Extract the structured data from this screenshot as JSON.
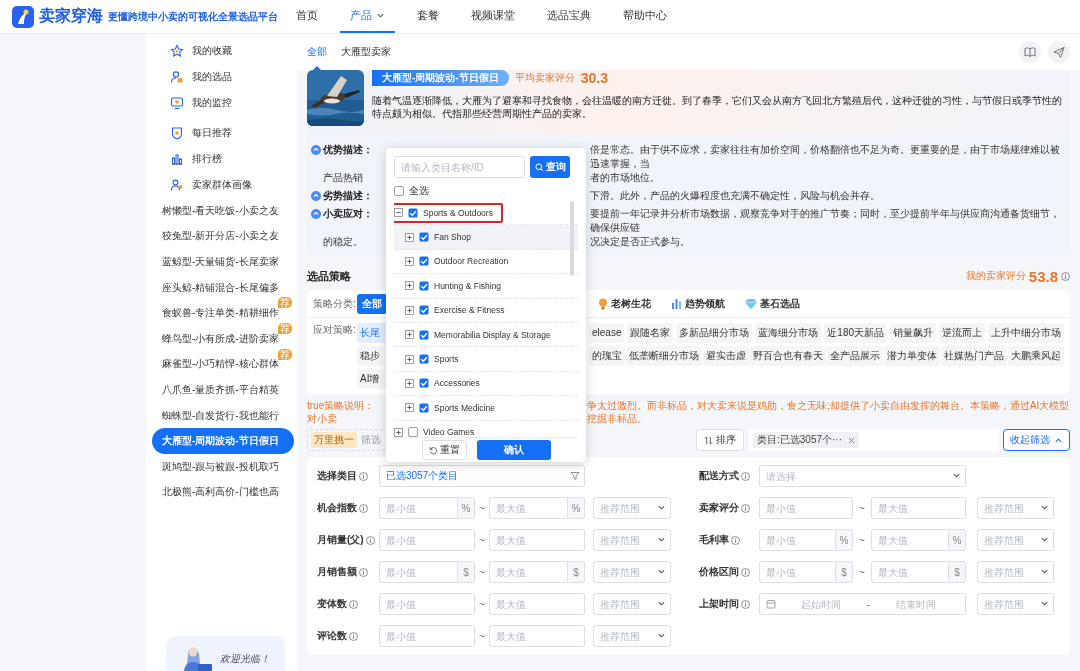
{
  "header": {
    "brand": "卖家穿海",
    "tagline": "更懂跨境中小卖的可视化全景选品平台",
    "nav": [
      {
        "label": "首页",
        "selected": false,
        "dropdown": false
      },
      {
        "label": "产品",
        "selected": true,
        "dropdown": true
      },
      {
        "label": "套餐",
        "selected": false,
        "dropdown": false
      },
      {
        "label": "视频课堂",
        "selected": false,
        "dropdown": false
      },
      {
        "label": "选品宝典",
        "selected": false,
        "dropdown": false
      },
      {
        "label": "帮助中心",
        "selected": false,
        "dropdown": false
      }
    ]
  },
  "sidebar": {
    "menu": [
      [
        {
          "label": "我的收藏"
        },
        {
          "label": "我的选品"
        },
        {
          "label": "我的监控"
        }
      ],
      [
        {
          "label": "每日推荐"
        },
        {
          "label": "排行榜"
        },
        {
          "label": "卖家群体画像"
        }
      ]
    ],
    "types": [
      {
        "label": "树懒型-看天吃饭-小卖之友",
        "selected": false
      },
      {
        "label": "狡兔型-新开分店-小卖之友",
        "selected": false
      },
      {
        "label": "蓝鲸型-天量铺货-长尾卖家",
        "selected": false
      },
      {
        "label": "座头鲸-精铺混合-长尾偏多",
        "selected": false
      },
      {
        "label": "食蚁兽-专注单类-精耕细作",
        "badge": "荐",
        "selected": false
      },
      {
        "label": "蜂鸟型-小有所成-进阶卖家",
        "badge": "荐",
        "selected": false
      },
      {
        "label": "麻雀型-小巧精悍-核心群体",
        "badge": "荐",
        "selected": false
      },
      {
        "label": "八爪鱼-量质齐抓-平台精英",
        "selected": false
      },
      {
        "label": "蜘蛛型-自发货行-我也能行",
        "selected": false
      },
      {
        "label": "大雁型-周期波动-节日假日",
        "selected": true
      },
      {
        "label": "斑鸠型-跟与被跟-投机取巧",
        "selected": false
      },
      {
        "label": "北极熊-高利高价-门槛也高",
        "selected": false
      }
    ],
    "welcome": "欢迎光临！"
  },
  "tabs": [
    {
      "label": "全部",
      "selected": true
    },
    {
      "label": "大雁型卖家",
      "selected": false
    }
  ],
  "hero": {
    "title": "大雁型-周期波动-节日假日",
    "score_label": "平均卖家评分",
    "score": "30.3",
    "description": "随着气温逐渐降低，大雁为了避寒和寻找食物，会往温暖的南方迁徙。到了春季，它们又会从南方飞回北方繁殖后代，这种迁徙的习性，与节假日或季节性的特点颇为相似。代指那些经营周期性产品的卖家。"
  },
  "insights": [
    {
      "label": "优势描述：",
      "lines": [
        {
          "right": "倍是常态。由于供不应求，卖家往往有加价空间，价格翻倍也不足为奇。更重要的是，由于市场规律难以被迅速掌握，当"
        },
        {
          "left": "产品热销",
          "right": "者的市场地位。"
        }
      ]
    },
    {
      "label": "劣势描述：",
      "lines": [
        {
          "right": "下滑。此外，产品的火爆程度也充满不确定性，风险与机会并存。"
        }
      ]
    },
    {
      "label": "小卖应对：",
      "lines": [
        {
          "right": "要提前一年记录并分析市场数据，观察竞争对手的推广节奏；同时，至少提前半年与供应商沟通备货细节，确保供应链"
        },
        {
          "left": "的稳定。",
          "right": "况决定是否正式参与。"
        }
      ]
    }
  ],
  "strategy": {
    "title": "选品策略",
    "score_label": "我的卖家评分",
    "score": "53.8",
    "category_label": "策略分类:",
    "categories": [
      {
        "label": "全部",
        "selected": true
      },
      {
        "label": "老树生花",
        "selected": false
      },
      {
        "label": "趋势领航",
        "selected": false
      },
      {
        "label": "基石选品",
        "selected": false
      }
    ],
    "response_label": "应对策略:",
    "chip_rows": [
      {
        "left": [
          {
            "label": "长尾",
            "selected": true
          }
        ],
        "right": [
          {
            "label": "elease",
            "selected": false
          },
          {
            "label": "跟随名家",
            "selected": false
          },
          {
            "label": "多新品细分市场",
            "selected": false
          },
          {
            "label": "蓝海细分市场",
            "selected": false
          },
          {
            "label": "近180天新品",
            "selected": false
          },
          {
            "label": "销量飙升",
            "selected": false
          },
          {
            "label": "逆流而上",
            "selected": false
          },
          {
            "label": "上升中细分市场",
            "selected": false
          }
        ]
      },
      {
        "left": [
          {
            "label": "稳步",
            "selected": false
          }
        ],
        "right": [
          {
            "label": "的瑰宝",
            "selected": false
          },
          {
            "label": "低垄断细分市场",
            "selected": false
          },
          {
            "label": "避实击虚",
            "selected": false
          },
          {
            "label": "野百合也有春天",
            "selected": false
          },
          {
            "label": "全产品展示",
            "selected": false
          },
          {
            "label": "潜力单变体",
            "selected": false
          },
          {
            "label": "社媒热门产品",
            "selected": false
          },
          {
            "label": "大鹏乘风起",
            "selected": false
          }
        ]
      },
      {
        "left": [
          {
            "label": "AI增",
            "selected": false
          }
        ]
      }
    ],
    "note": {
      "left": "true策略说明：对小卖",
      "right": "争太过激烈。而非标品，对大卖来说是鸡肋，食之无味;却提供了小卖自由发挥的舞台。本策略，通过AI大模型挖掘非标品。"
    }
  },
  "filter_bar": {
    "tag": "万里挑一",
    "hint": "筛选",
    "sort": "排序",
    "chip": "类目:已选3057个···",
    "collapse": "收起筛选"
  },
  "form": {
    "left": [
      {
        "label": "选择类目",
        "kind": "category",
        "value": "已选3057个类目"
      },
      {
        "label": "机会指数",
        "kind": "range",
        "min": {
          "placeholder": "最小值",
          "unit": "%"
        },
        "sep": "~",
        "max": {
          "placeholder": "最大值",
          "unit": "%"
        },
        "preset": {
          "placeholder": "推荐范围"
        }
      },
      {
        "label": "月销量(父)",
        "kind": "range",
        "min": {
          "placeholder": "最小值"
        },
        "sep": "~",
        "max": {
          "placeholder": "最大值"
        },
        "preset": {
          "placeholder": "推荐范围"
        }
      },
      {
        "label": "月销售额",
        "kind": "range",
        "min": {
          "placeholder": "最小值",
          "unit": "$"
        },
        "sep": "~",
        "max": {
          "placeholder": "最大值",
          "unit": "$"
        },
        "preset": {
          "placeholder": "推荐范围"
        }
      },
      {
        "label": "变体数",
        "kind": "range",
        "min": {
          "placeholder": "最小值"
        },
        "sep": "~",
        "max": {
          "placeholder": "最大值"
        },
        "preset": {
          "placeholder": "推荐范围"
        }
      },
      {
        "label": "评论数",
        "kind": "range",
        "min": {
          "placeholder": "最小值"
        },
        "sep": "~",
        "max": {
          "placeholder": "最大值"
        },
        "preset": {
          "placeholder": "推荐范围"
        }
      }
    ],
    "right": [
      {
        "label": "配送方式",
        "kind": "select",
        "placeholder": "请选择"
      },
      {
        "label": "卖家评分",
        "kind": "range",
        "min": {
          "placeholder": "最小值"
        },
        "sep": "~",
        "max": {
          "placeholder": "最大值"
        },
        "preset": {
          "placeholder": "推荐范围"
        }
      },
      {
        "label": "毛利率",
        "kind": "range",
        "min": {
          "placeholder": "最小值",
          "unit": "%"
        },
        "sep": "~",
        "max": {
          "placeholder": "最大值",
          "unit": "%"
        },
        "preset": {
          "placeholder": "推荐范围"
        }
      },
      {
        "label": "价格区间",
        "kind": "range",
        "min": {
          "placeholder": "最小值",
          "unit": "$"
        },
        "sep": "~",
        "max": {
          "placeholder": "最大值",
          "unit": "$"
        },
        "preset": {
          "placeholder": "推荐范围"
        }
      },
      {
        "label": "上架时间",
        "kind": "date",
        "start": {
          "placeholder": "起始时间"
        },
        "sep": "-",
        "end": {
          "placeholder": "结束时间"
        },
        "preset": {
          "placeholder": "推荐范围"
        }
      }
    ]
  },
  "popup": {
    "search": {
      "placeholder": "请输入类目名称/ID",
      "button": "查询"
    },
    "select_all": {
      "label": "全选",
      "checked": false
    },
    "tree": [
      {
        "label": "Sports & Outdoors",
        "checked": true,
        "expanded": true,
        "annotated": true,
        "hovered": false,
        "children": [
          {
            "label": "Fan Shop",
            "checked": true,
            "expanded": false,
            "annotated": false,
            "hovered": true
          },
          {
            "label": "Outdoor Recreation",
            "checked": true,
            "expanded": false,
            "annotated": false,
            "hovered": false
          },
          {
            "label": "Hunting & Fishing",
            "checked": true,
            "expanded": false,
            "annotated": false,
            "hovered": false
          },
          {
            "label": "Exercise & Fitness",
            "checked": true,
            "expanded": false,
            "annotated": false,
            "hovered": false
          },
          {
            "label": "Memorabilia Display & Storage",
            "checked": true,
            "expanded": false,
            "annotated": false,
            "hovered": false
          },
          {
            "label": "Sports",
            "checked": true,
            "expanded": false,
            "annotated": false,
            "hovered": false
          },
          {
            "label": "Accessories",
            "checked": true,
            "expanded": false,
            "annotated": false,
            "hovered": false
          },
          {
            "label": "Sports Medicine",
            "checked": true,
            "expanded": false,
            "annotated": false,
            "hovered": false
          }
        ]
      },
      {
        "label": "Video Games",
        "checked": false,
        "expanded": false,
        "annotated": false,
        "hovered": false
      }
    ],
    "reset": "重置",
    "confirm": "确认"
  }
}
